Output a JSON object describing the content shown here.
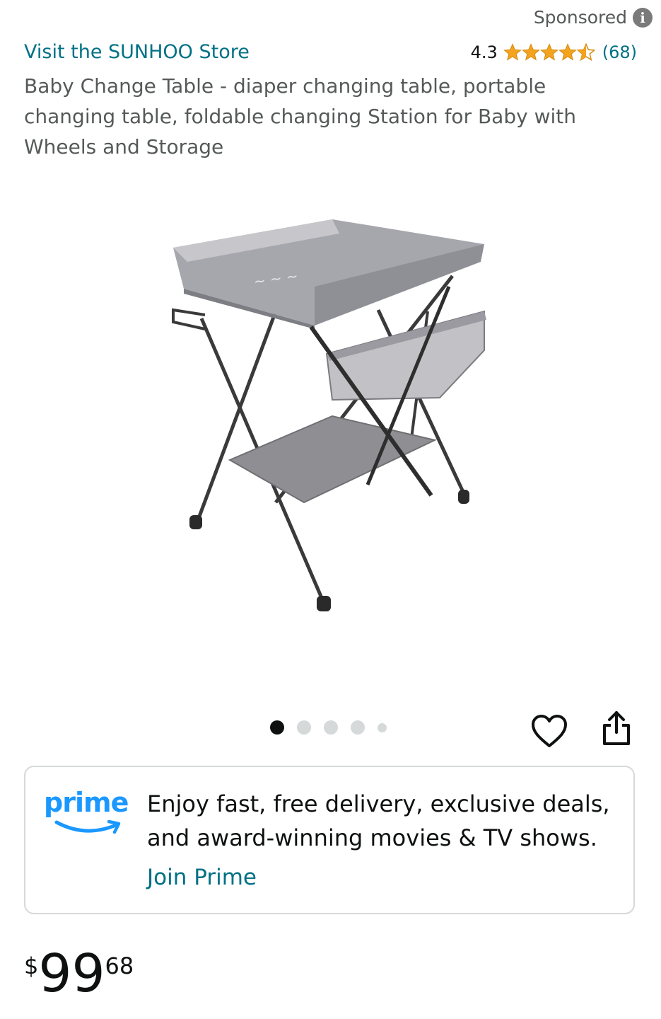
{
  "sponsored": {
    "label": "Sponsored",
    "icon": "info-icon"
  },
  "store": {
    "link_text": "Visit the SUNHOO Store"
  },
  "rating": {
    "value": "4.3",
    "stars": 4.3,
    "max_stars": 5,
    "review_count": "(68)",
    "star_color": "#F4A31F"
  },
  "product": {
    "title": "Baby Change Table - diaper changing table, portable changing table, foldable changing Station for Baby with Wheels and Storage"
  },
  "gallery": {
    "image_count": 5,
    "active_index": 0
  },
  "actions": {
    "favorite_icon": "heart-icon",
    "share_icon": "share-icon"
  },
  "prime": {
    "logo_text": "prime",
    "message": "Enjoy fast, free delivery, exclusive deals, and award-winning movies & TV shows.",
    "link_text": "Join Prime",
    "brand_color": "#1A98FF"
  },
  "price": {
    "symbol": "$",
    "whole": "99",
    "fraction": "68"
  },
  "colors": {
    "link": "#007185",
    "text": "#0F1111",
    "muted": "#565959",
    "border": "#d5d9d9"
  }
}
